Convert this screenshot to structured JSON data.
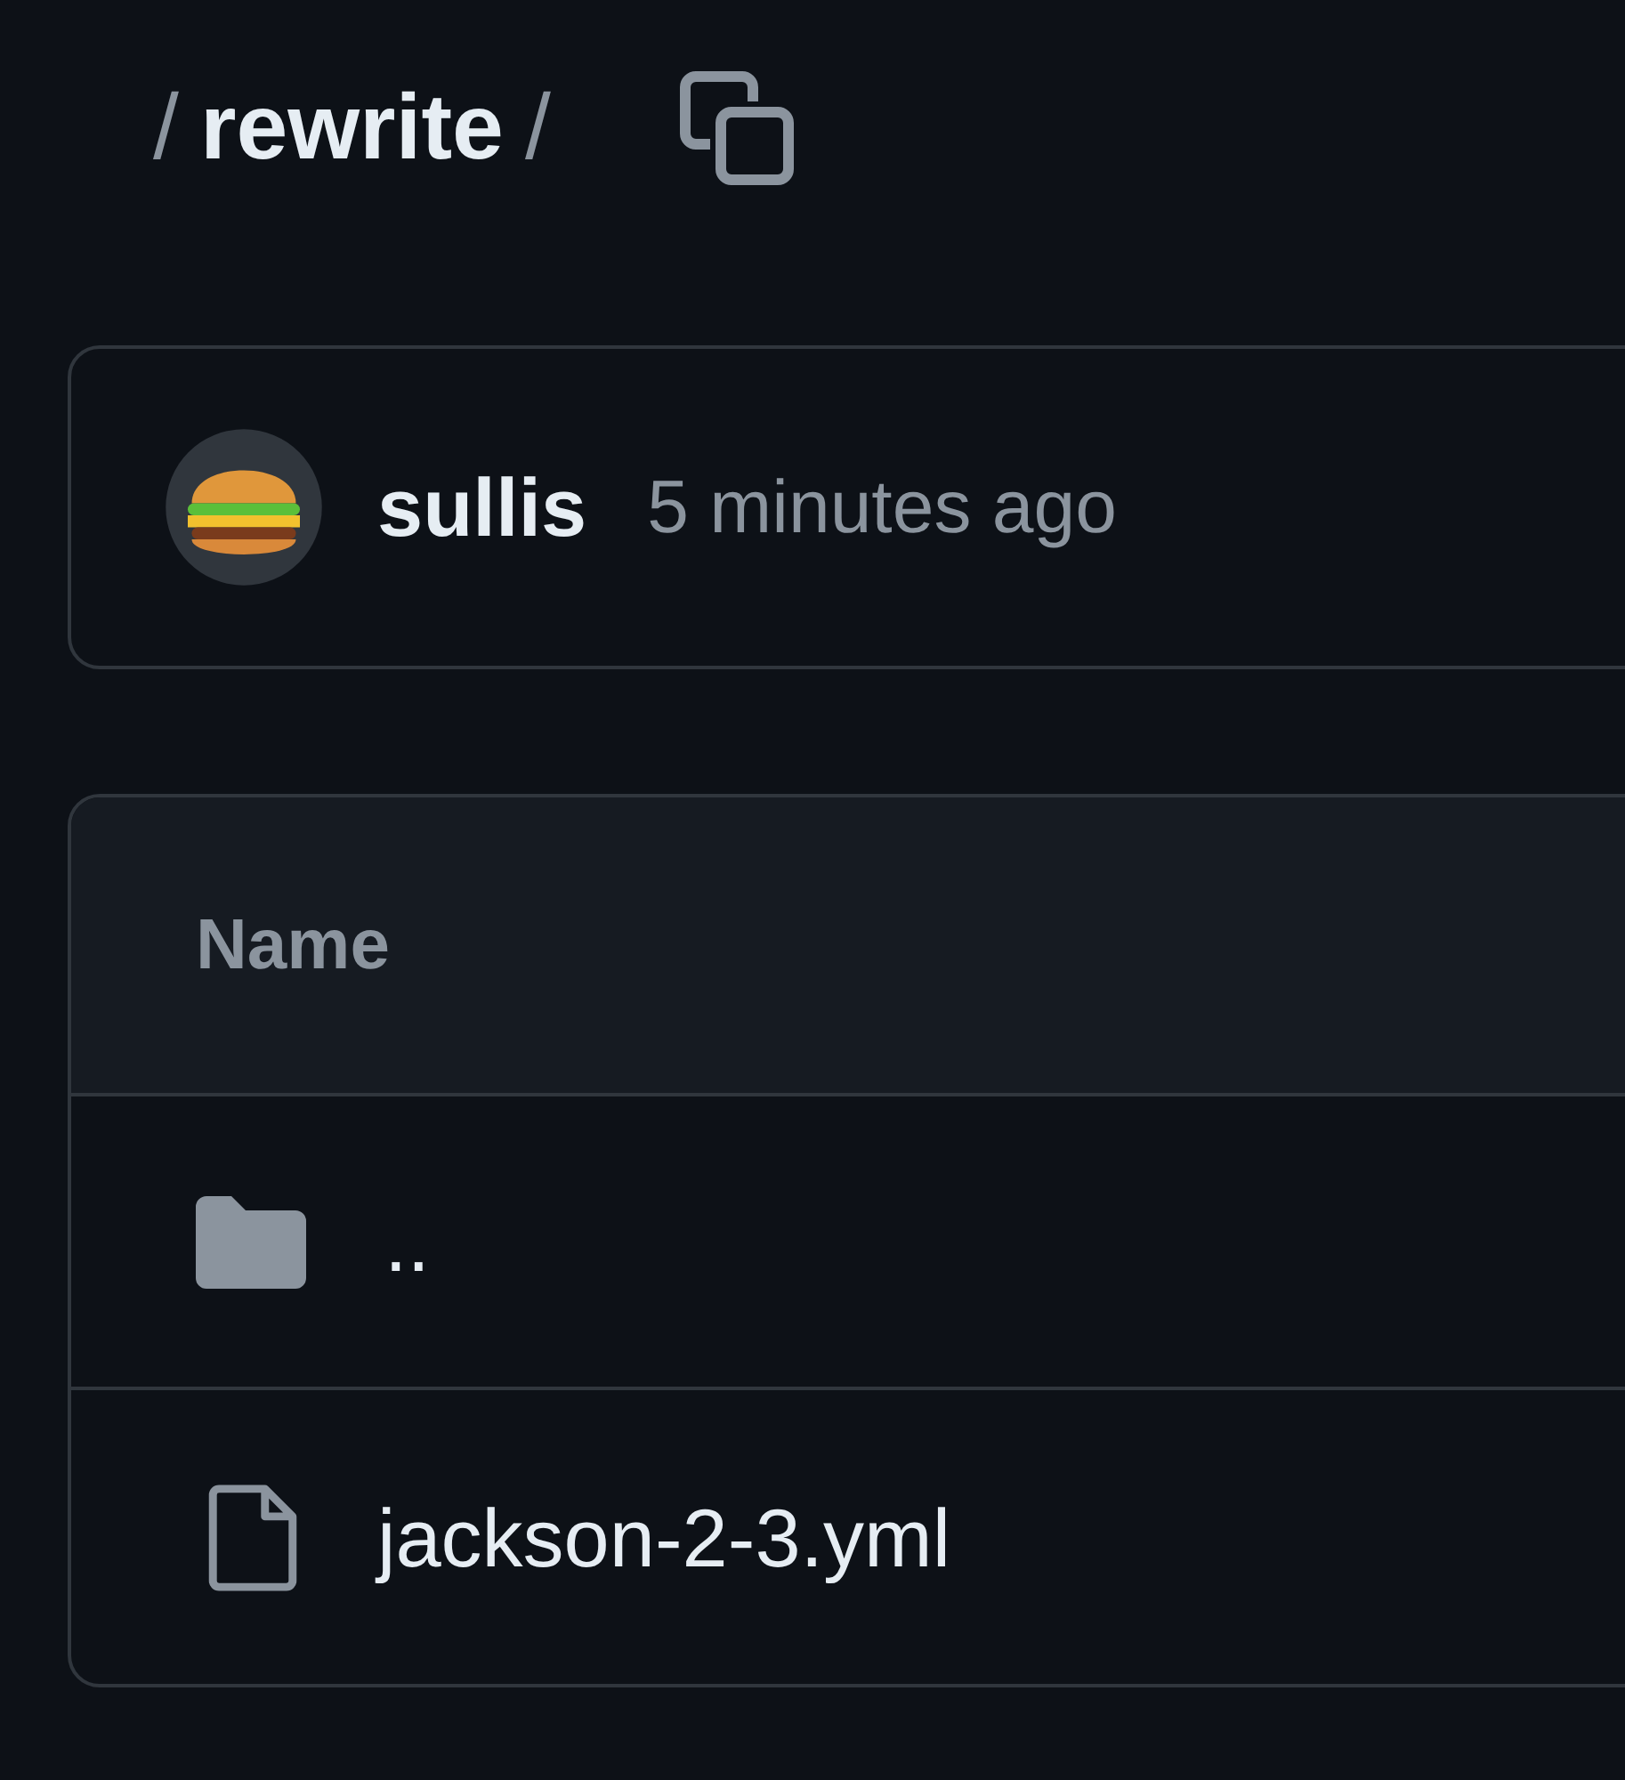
{
  "breadcrumb": [
    {
      "kind": "separator",
      "text": "/"
    },
    {
      "kind": "segment",
      "text": "rewrite"
    },
    {
      "kind": "separator",
      "text": "/"
    }
  ],
  "commit": {
    "author": "sullis",
    "time": "5 minutes ago"
  },
  "table": {
    "columns": [
      "Name"
    ],
    "rows": [
      {
        "kind": "folder",
        "name": ".."
      },
      {
        "kind": "file",
        "name": "jackson-2-3.yml"
      }
    ]
  }
}
